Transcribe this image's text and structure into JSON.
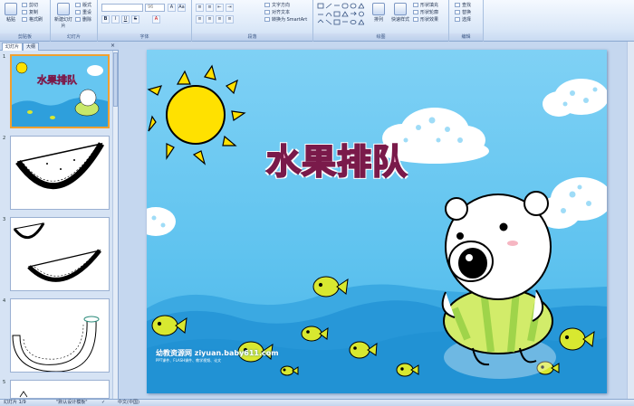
{
  "ribbon": {
    "clipboard": {
      "label": "剪贴板",
      "paste": "粘贴",
      "cut": "剪切",
      "copy": "复制",
      "format_painter": "格式刷"
    },
    "slides": {
      "label": "幻灯片",
      "new_slide": "新建幻灯片",
      "layout": "版式",
      "reset": "重设",
      "delete": "删除"
    },
    "font": {
      "label": "字体",
      "font_name": "",
      "font_size": "96",
      "buttons": [
        "B",
        "I",
        "U",
        "S",
        "A",
        "Aa",
        "A"
      ]
    },
    "paragraph": {
      "label": "段落",
      "text_direction": "文字方向",
      "align_text": "对齐文本",
      "smartart": "转换为 SmartArt"
    },
    "drawing": {
      "label": "绘图",
      "arrange": "排列",
      "quick_styles": "快速样式",
      "shape_fill": "形状填充",
      "shape_outline": "形状轮廓",
      "shape_effects": "形状效果"
    },
    "editing": {
      "label": "编辑",
      "find": "查找",
      "replace": "替换",
      "select": "选择"
    }
  },
  "panel": {
    "tabs": [
      "幻灯片",
      "大纲"
    ],
    "close": "×",
    "slide_numbers": [
      "1",
      "2",
      "3",
      "4",
      "5"
    ]
  },
  "slide": {
    "title": "水果排队",
    "watermark": "幼教资源网 ziyuan.baby611.com",
    "watermark_sub": "PPT课件、FLASH课件、教学视频、论文"
  },
  "status": {
    "slide_info": "幻灯片 1/9",
    "theme": "\"默认设计模板\"",
    "language": "中文(中国)"
  },
  "colors": {
    "sky": "#5fc3ef",
    "sun": "#ffe100",
    "wave": "#2e9fdc",
    "fish": "#d8e830",
    "selected_border": "#f0a030"
  }
}
